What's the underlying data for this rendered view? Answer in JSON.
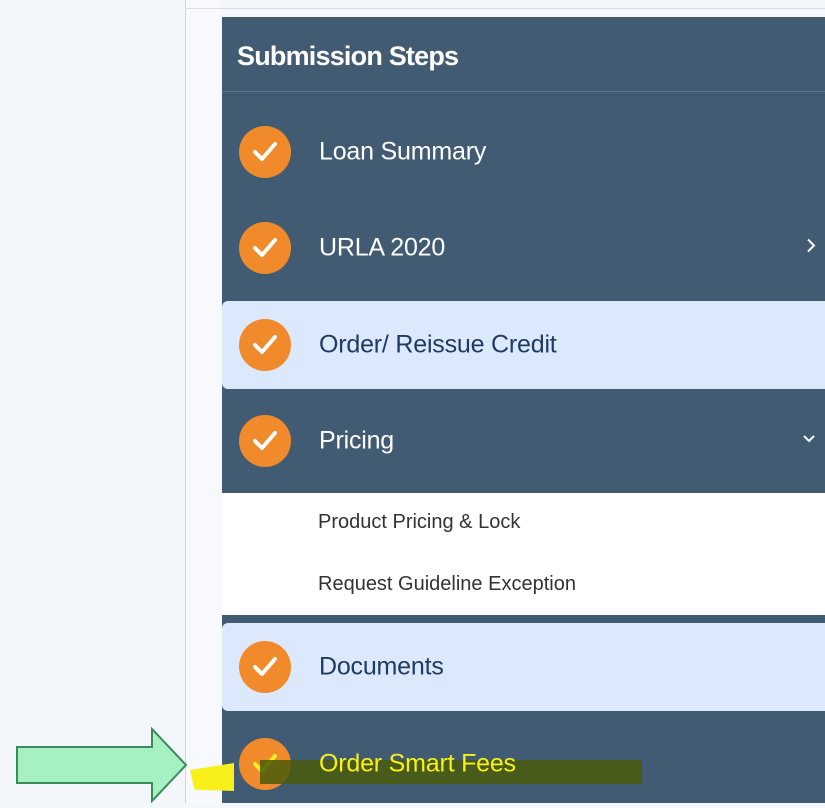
{
  "panel": {
    "title": "Submission Steps"
  },
  "steps": [
    {
      "label": "Loan Summary",
      "status": "complete",
      "icon": "check-icon"
    },
    {
      "label": "URLA 2020",
      "status": "complete",
      "icon": "check-icon",
      "expander": "chevron-right-icon"
    },
    {
      "label": "Order/ Reissue Credit",
      "status": "complete",
      "icon": "check-icon",
      "highlighted": true
    },
    {
      "label": "Pricing",
      "status": "complete",
      "icon": "check-icon",
      "expander": "chevron-down-icon",
      "expanded": true
    },
    {
      "label": "Documents",
      "status": "complete",
      "icon": "check-icon",
      "highlighted": true
    },
    {
      "label": "Order Smart Fees",
      "status": "complete",
      "icon": "check-icon"
    }
  ],
  "pricing_substeps": [
    {
      "label": "Product Pricing & Lock"
    },
    {
      "label": "Request Guideline Exception"
    }
  ],
  "colors": {
    "panel_bg": "#415b73",
    "highlight_bg": "#dce8fb",
    "check_orange": "#f08a2a",
    "annotation_arrow": "#a6f0c3",
    "annotation_marker_yellow": "#f7f01b",
    "annotation_marker_olive": "#4a5c0a"
  }
}
